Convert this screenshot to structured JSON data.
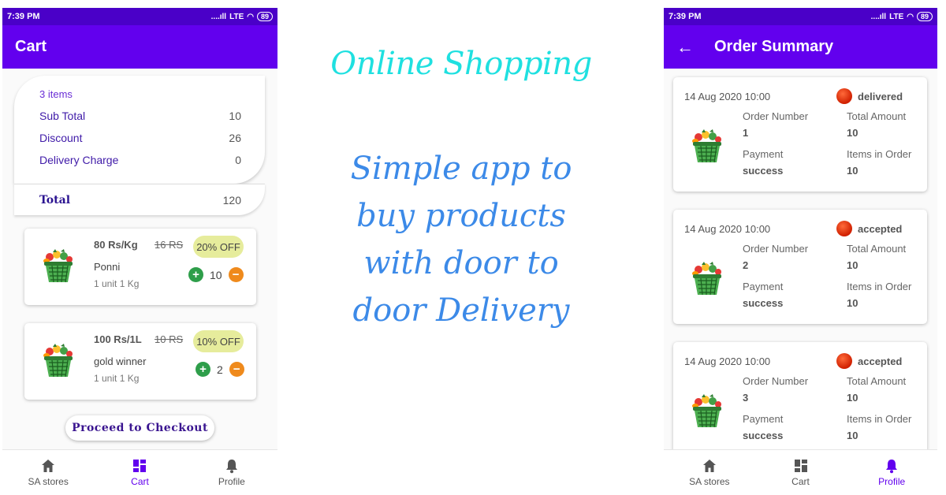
{
  "left_phone": {
    "status": {
      "time": "7:39 PM",
      "signal": "....ıll",
      "network": "LTE",
      "battery": "89"
    },
    "appbar_title": "Cart",
    "summary": {
      "items_count": "3 items",
      "rows": [
        {
          "label": "Sub Total",
          "value": "10"
        },
        {
          "label": "Discount",
          "value": "26"
        },
        {
          "label": "Delivery Charge",
          "value": "0"
        }
      ],
      "total_label": "Total",
      "total_value": "120"
    },
    "products": [
      {
        "price": "80 Rs/Kg",
        "old_price": "16 RS",
        "discount": "20% OFF",
        "name": "Ponni",
        "unit": "1 unit 1 Kg",
        "qty": "10",
        "plus": "+",
        "minus": "−"
      },
      {
        "price": "100 Rs/1L",
        "old_price": "10 RS",
        "discount": "10% OFF",
        "name": "gold winner",
        "unit": "1 unit 1 Kg",
        "qty": "2",
        "plus": "+",
        "minus": "−"
      }
    ],
    "checkout_label": "Proceed to Checkout",
    "nav": [
      {
        "label": "SA stores",
        "icon": "home-icon"
      },
      {
        "label": "Cart",
        "icon": "grid-icon"
      },
      {
        "label": "Profile",
        "icon": "bell-icon"
      }
    ],
    "active_nav": "Cart"
  },
  "center": {
    "headline": "Online Shopping",
    "tagline_lines": [
      "Simple app to",
      "buy products",
      "with door to",
      "door Delivery"
    ]
  },
  "right_phone": {
    "status": {
      "time": "7:39 PM",
      "signal": "....ıll",
      "network": "LTE",
      "battery": "89"
    },
    "back_icon": "arrow-left-icon",
    "appbar_title": "Order Summary",
    "labels": {
      "order_number": "Order Number",
      "total_amount": "Total Amount",
      "payment": "Payment",
      "items_in_order": "Items in Order"
    },
    "orders": [
      {
        "date": "14 Aug 2020 10:00",
        "status": "delivered",
        "order_number": "1",
        "total_amount": "10",
        "payment": "success",
        "items": "10"
      },
      {
        "date": "14 Aug 2020 10:00",
        "status": "accepted",
        "order_number": "2",
        "total_amount": "10",
        "payment": "success",
        "items": "10"
      },
      {
        "date": "14 Aug 2020 10:00",
        "status": "accepted",
        "order_number": "3",
        "total_amount": "10",
        "payment": "success",
        "items": "10"
      }
    ],
    "nav": [
      {
        "label": "SA stores",
        "icon": "home-icon"
      },
      {
        "label": "Cart",
        "icon": "grid-icon"
      },
      {
        "label": "Profile",
        "icon": "bell-icon"
      }
    ],
    "active_nav": "Profile"
  },
  "colors": {
    "primary": "#6200ee",
    "status_bar": "#4a00c8",
    "headline": "#1fe0e0",
    "tagline": "#3c8ae8",
    "plus": "#2e9e4a",
    "minus": "#ef8a1c",
    "off_badge": "#e6ec9c"
  }
}
